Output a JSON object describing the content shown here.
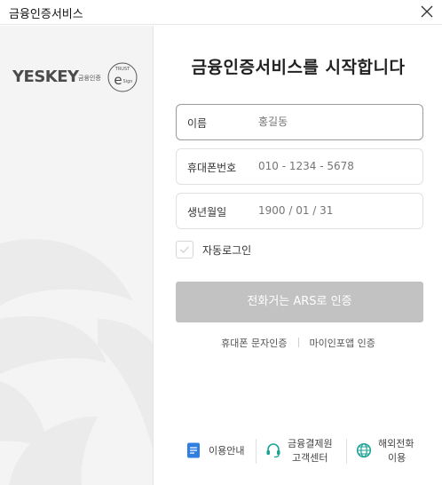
{
  "window": {
    "title": "금융인증서비스"
  },
  "logo": {
    "word": "YESKEY",
    "sub": "금융인증",
    "seal_top": "TRUST",
    "seal_bottom": "Sign"
  },
  "heading": "금융인증서비스를 시작합니다",
  "form": {
    "name": {
      "label": "이름",
      "placeholder": "홍길동"
    },
    "phone": {
      "label": "휴대폰번호",
      "placeholder": "010 - 1234 - 5678"
    },
    "birth": {
      "label": "생년월일",
      "placeholder": "1900 / 01 / 31"
    },
    "auto_login": {
      "label": "자동로그인",
      "checked": false
    }
  },
  "buttons": {
    "ars": "전화거는 ARS로 인증"
  },
  "links": {
    "sms": "휴대폰 문자인증",
    "mydata": "마이인포앱 인증"
  },
  "bottom": {
    "guide": "이용안내",
    "center_line1": "금융결제원",
    "center_line2": "고객센터",
    "overseas_line1": "해외전화",
    "overseas_line2": "이용"
  },
  "colors": {
    "button_disabled": "#c2c2c2",
    "accent_blue": "#2f7fe0",
    "accent_green": "#1aa394"
  }
}
